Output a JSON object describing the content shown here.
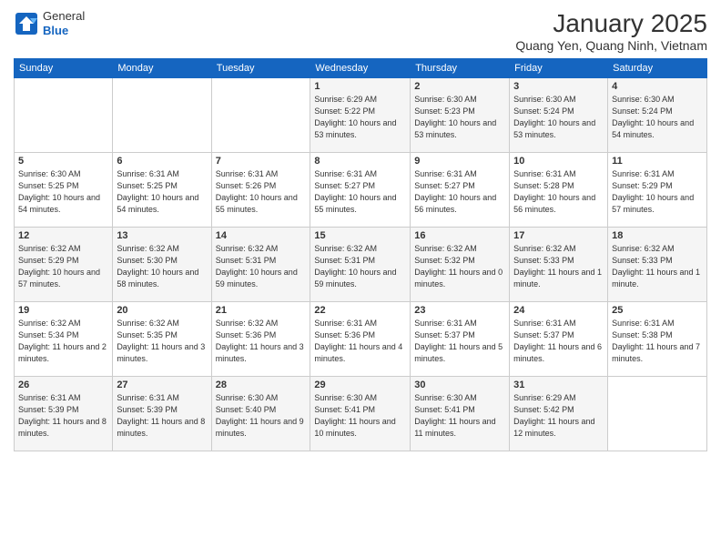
{
  "header": {
    "logo_general": "General",
    "logo_blue": "Blue",
    "title": "January 2025",
    "subtitle": "Quang Yen, Quang Ninh, Vietnam"
  },
  "weekdays": [
    "Sunday",
    "Monday",
    "Tuesday",
    "Wednesday",
    "Thursday",
    "Friday",
    "Saturday"
  ],
  "weeks": [
    [
      {
        "day": "",
        "sunrise": "",
        "sunset": "",
        "daylight": ""
      },
      {
        "day": "",
        "sunrise": "",
        "sunset": "",
        "daylight": ""
      },
      {
        "day": "",
        "sunrise": "",
        "sunset": "",
        "daylight": ""
      },
      {
        "day": "1",
        "sunrise": "Sunrise: 6:29 AM",
        "sunset": "Sunset: 5:22 PM",
        "daylight": "Daylight: 10 hours and 53 minutes."
      },
      {
        "day": "2",
        "sunrise": "Sunrise: 6:30 AM",
        "sunset": "Sunset: 5:23 PM",
        "daylight": "Daylight: 10 hours and 53 minutes."
      },
      {
        "day": "3",
        "sunrise": "Sunrise: 6:30 AM",
        "sunset": "Sunset: 5:24 PM",
        "daylight": "Daylight: 10 hours and 53 minutes."
      },
      {
        "day": "4",
        "sunrise": "Sunrise: 6:30 AM",
        "sunset": "Sunset: 5:24 PM",
        "daylight": "Daylight: 10 hours and 54 minutes."
      }
    ],
    [
      {
        "day": "5",
        "sunrise": "Sunrise: 6:30 AM",
        "sunset": "Sunset: 5:25 PM",
        "daylight": "Daylight: 10 hours and 54 minutes."
      },
      {
        "day": "6",
        "sunrise": "Sunrise: 6:31 AM",
        "sunset": "Sunset: 5:25 PM",
        "daylight": "Daylight: 10 hours and 54 minutes."
      },
      {
        "day": "7",
        "sunrise": "Sunrise: 6:31 AM",
        "sunset": "Sunset: 5:26 PM",
        "daylight": "Daylight: 10 hours and 55 minutes."
      },
      {
        "day": "8",
        "sunrise": "Sunrise: 6:31 AM",
        "sunset": "Sunset: 5:27 PM",
        "daylight": "Daylight: 10 hours and 55 minutes."
      },
      {
        "day": "9",
        "sunrise": "Sunrise: 6:31 AM",
        "sunset": "Sunset: 5:27 PM",
        "daylight": "Daylight: 10 hours and 56 minutes."
      },
      {
        "day": "10",
        "sunrise": "Sunrise: 6:31 AM",
        "sunset": "Sunset: 5:28 PM",
        "daylight": "Daylight: 10 hours and 56 minutes."
      },
      {
        "day": "11",
        "sunrise": "Sunrise: 6:31 AM",
        "sunset": "Sunset: 5:29 PM",
        "daylight": "Daylight: 10 hours and 57 minutes."
      }
    ],
    [
      {
        "day": "12",
        "sunrise": "Sunrise: 6:32 AM",
        "sunset": "Sunset: 5:29 PM",
        "daylight": "Daylight: 10 hours and 57 minutes."
      },
      {
        "day": "13",
        "sunrise": "Sunrise: 6:32 AM",
        "sunset": "Sunset: 5:30 PM",
        "daylight": "Daylight: 10 hours and 58 minutes."
      },
      {
        "day": "14",
        "sunrise": "Sunrise: 6:32 AM",
        "sunset": "Sunset: 5:31 PM",
        "daylight": "Daylight: 10 hours and 59 minutes."
      },
      {
        "day": "15",
        "sunrise": "Sunrise: 6:32 AM",
        "sunset": "Sunset: 5:31 PM",
        "daylight": "Daylight: 10 hours and 59 minutes."
      },
      {
        "day": "16",
        "sunrise": "Sunrise: 6:32 AM",
        "sunset": "Sunset: 5:32 PM",
        "daylight": "Daylight: 11 hours and 0 minutes."
      },
      {
        "day": "17",
        "sunrise": "Sunrise: 6:32 AM",
        "sunset": "Sunset: 5:33 PM",
        "daylight": "Daylight: 11 hours and 1 minute."
      },
      {
        "day": "18",
        "sunrise": "Sunrise: 6:32 AM",
        "sunset": "Sunset: 5:33 PM",
        "daylight": "Daylight: 11 hours and 1 minute."
      }
    ],
    [
      {
        "day": "19",
        "sunrise": "Sunrise: 6:32 AM",
        "sunset": "Sunset: 5:34 PM",
        "daylight": "Daylight: 11 hours and 2 minutes."
      },
      {
        "day": "20",
        "sunrise": "Sunrise: 6:32 AM",
        "sunset": "Sunset: 5:35 PM",
        "daylight": "Daylight: 11 hours and 3 minutes."
      },
      {
        "day": "21",
        "sunrise": "Sunrise: 6:32 AM",
        "sunset": "Sunset: 5:36 PM",
        "daylight": "Daylight: 11 hours and 3 minutes."
      },
      {
        "day": "22",
        "sunrise": "Sunrise: 6:31 AM",
        "sunset": "Sunset: 5:36 PM",
        "daylight": "Daylight: 11 hours and 4 minutes."
      },
      {
        "day": "23",
        "sunrise": "Sunrise: 6:31 AM",
        "sunset": "Sunset: 5:37 PM",
        "daylight": "Daylight: 11 hours and 5 minutes."
      },
      {
        "day": "24",
        "sunrise": "Sunrise: 6:31 AM",
        "sunset": "Sunset: 5:37 PM",
        "daylight": "Daylight: 11 hours and 6 minutes."
      },
      {
        "day": "25",
        "sunrise": "Sunrise: 6:31 AM",
        "sunset": "Sunset: 5:38 PM",
        "daylight": "Daylight: 11 hours and 7 minutes."
      }
    ],
    [
      {
        "day": "26",
        "sunrise": "Sunrise: 6:31 AM",
        "sunset": "Sunset: 5:39 PM",
        "daylight": "Daylight: 11 hours and 8 minutes."
      },
      {
        "day": "27",
        "sunrise": "Sunrise: 6:31 AM",
        "sunset": "Sunset: 5:39 PM",
        "daylight": "Daylight: 11 hours and 8 minutes."
      },
      {
        "day": "28",
        "sunrise": "Sunrise: 6:30 AM",
        "sunset": "Sunset: 5:40 PM",
        "daylight": "Daylight: 11 hours and 9 minutes."
      },
      {
        "day": "29",
        "sunrise": "Sunrise: 6:30 AM",
        "sunset": "Sunset: 5:41 PM",
        "daylight": "Daylight: 11 hours and 10 minutes."
      },
      {
        "day": "30",
        "sunrise": "Sunrise: 6:30 AM",
        "sunset": "Sunset: 5:41 PM",
        "daylight": "Daylight: 11 hours and 11 minutes."
      },
      {
        "day": "31",
        "sunrise": "Sunrise: 6:29 AM",
        "sunset": "Sunset: 5:42 PM",
        "daylight": "Daylight: 11 hours and 12 minutes."
      },
      {
        "day": "",
        "sunrise": "",
        "sunset": "",
        "daylight": ""
      }
    ]
  ]
}
